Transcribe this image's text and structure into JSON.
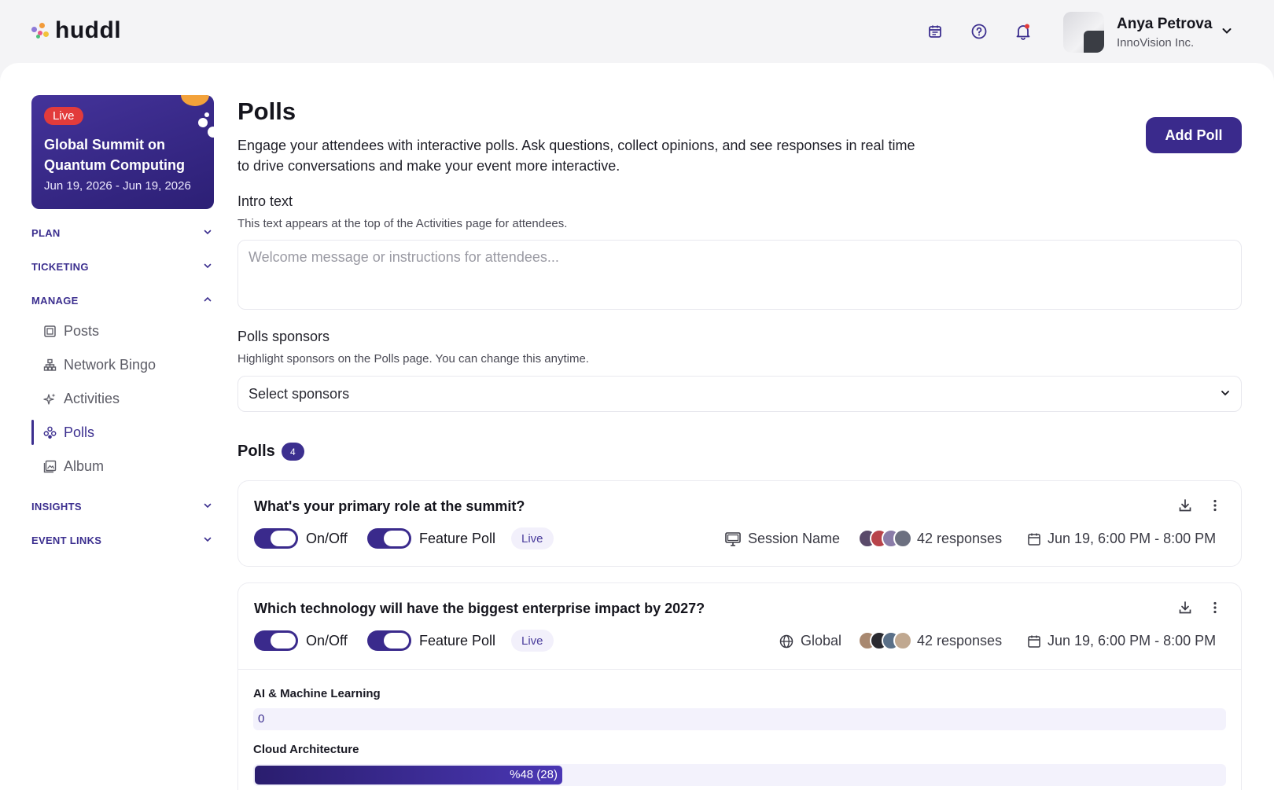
{
  "brand": {
    "name": "huddl"
  },
  "header": {
    "icons": [
      "calendar-icon",
      "help-icon",
      "notification-bell-icon"
    ],
    "user": {
      "name": "Anya Petrova",
      "org": "InnoVision Inc."
    }
  },
  "event": {
    "status": "Live",
    "title": "Global Summit on Quantum Computing",
    "dates": "Jun 19, 2026 - Jun 19, 2026"
  },
  "sidebar": {
    "sections": {
      "plan": "PLAN",
      "ticketing": "TICKETING",
      "manage": "MANAGE",
      "insights": "INSIGHTS",
      "event_links": "EVENT LINKS"
    },
    "manage_items": [
      {
        "label": "Posts",
        "icon": "posts-icon"
      },
      {
        "label": "Network Bingo",
        "icon": "network-icon"
      },
      {
        "label": "Activities",
        "icon": "sparkle-icon"
      },
      {
        "label": "Polls",
        "icon": "polls-icon",
        "active": true
      },
      {
        "label": "Album",
        "icon": "album-icon"
      }
    ]
  },
  "page": {
    "title": "Polls",
    "description": "Engage your attendees with interactive polls. Ask questions, collect opinions, and see responses in real time to drive conversations and make your event more interactive.",
    "add_button": "Add Poll"
  },
  "intro": {
    "label": "Intro text",
    "help": "This text appears at the top of the Activities page for attendees.",
    "placeholder": "Welcome message or instructions for attendees..."
  },
  "sponsors": {
    "label": "Polls sponsors",
    "help": "Highlight sponsors on the Polls page. You can change this anytime.",
    "placeholder": "Select sponsors"
  },
  "polls": {
    "heading": "Polls",
    "count": "4",
    "items": [
      {
        "question": "What's your primary role at the summit?",
        "toggle_label": "On/Off",
        "feature_label": "Feature Poll",
        "status": "Live",
        "location": "Session Name",
        "location_icon": "monitor-icon",
        "responses": "42 responses",
        "time": "Jun 19, 6:00 PM - 8:00 PM"
      },
      {
        "question": "Which technology will have the biggest enterprise impact by 2027?",
        "toggle_label": "On/Off",
        "feature_label": "Feature Poll",
        "status": "Live",
        "location": "Global",
        "location_icon": "globe-icon",
        "responses": "42 responses",
        "time": "Jun 19, 6:00 PM - 8:00 PM",
        "options": [
          {
            "label": "AI & Machine Learning",
            "value_text": "0",
            "percent": 0
          },
          {
            "label": "Cloud Architecture",
            "value_text": "%48 (28)",
            "percent": 48
          }
        ]
      }
    ]
  },
  "colors": {
    "accent": "#3a2a8c",
    "live_red": "#e23b3b"
  }
}
